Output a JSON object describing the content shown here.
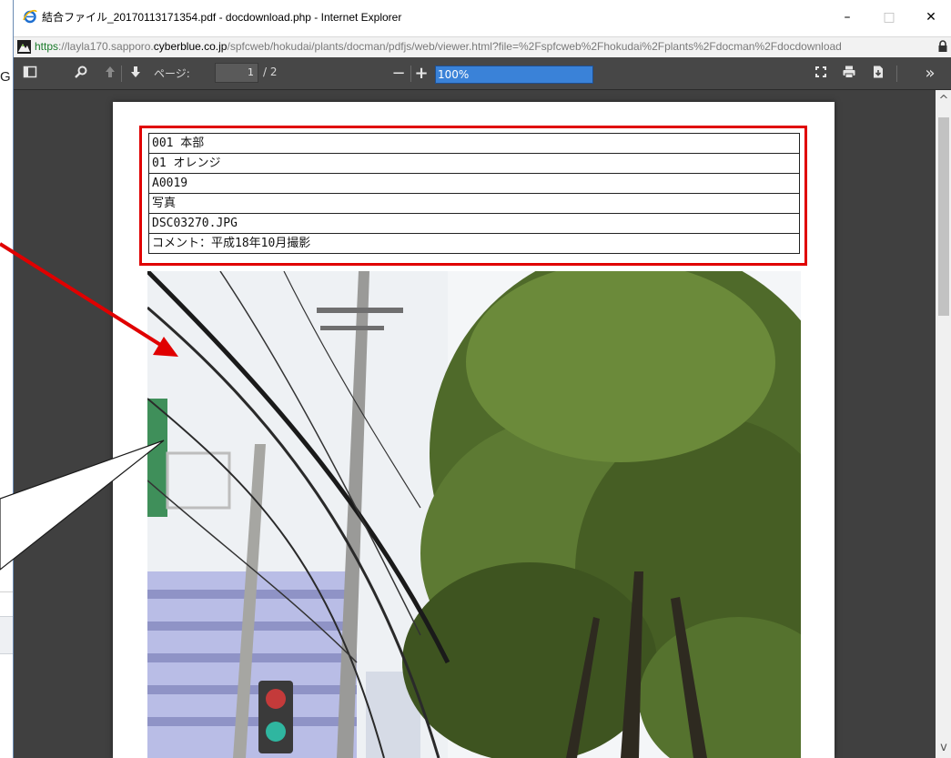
{
  "window": {
    "title": "結合ファイル_20170113171354.pdf - docdownload.php - Internet Explorer",
    "minimize": "–",
    "maximize": "□",
    "close": "✕"
  },
  "address": {
    "scheme": "https",
    "host_pre": "://layla170.sapporo.",
    "host_main": "cyberblue.co.jp",
    "path": "/spfcweb/hokudai/plants/docman/pdfjs/web/viewer.html?file=%2Fspfcweb%2Fhokudai%2Fplants%2Fdocman%2Fdocdownload"
  },
  "background_app": {
    "fragment": "G"
  },
  "toolbar": {
    "page_label": "ページ:",
    "page_value": "1",
    "page_total": "/ 2",
    "zoom_value": "100%",
    "zoom_out": "−",
    "zoom_in": "+",
    "more": "»"
  },
  "document": {
    "rows": [
      "001 本部",
      "01 オレンジ",
      "A0019",
      "写真",
      "DSC03270.JPG",
      "コメント：平成18年10月撮影"
    ]
  },
  "colors": {
    "highlight": "#e00000",
    "toolbar": "#474747",
    "viewer_bg": "#404040",
    "zoom_accent": "#3a82d8"
  },
  "icons": {
    "sidebar": "sidebar-toggle-icon",
    "find": "search-icon",
    "prev": "arrow-up-icon",
    "next": "arrow-down-icon",
    "presentation": "fullscreen-icon",
    "print": "print-icon",
    "download": "download-icon"
  }
}
